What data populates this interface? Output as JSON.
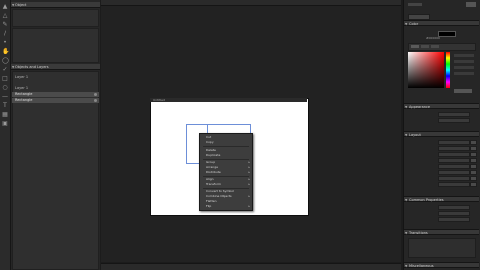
{
  "left_panels": {
    "top_panel": {
      "title": "Object"
    },
    "layers_panel": {
      "title": "Objects and Layers",
      "rows": [
        {
          "label": "Layer 1"
        },
        {
          "label": "Layer 1"
        },
        {
          "label": "Rectangle"
        },
        {
          "label": "Rectangle"
        }
      ]
    }
  },
  "document": {
    "title": "Untitled"
  },
  "context_menu": {
    "items": [
      {
        "label": "Cut"
      },
      {
        "label": "Copy"
      },
      {
        "label": "Delete"
      },
      {
        "label": "Duplicate"
      },
      {
        "label": "Group"
      },
      {
        "label": "Arrange"
      },
      {
        "label": "Distribute"
      },
      {
        "label": "Align"
      },
      {
        "label": "Transform"
      },
      {
        "label": "Convert to Symbol"
      },
      {
        "label": "Combine Objects"
      },
      {
        "label": "Flatten"
      },
      {
        "label": "Flip"
      },
      {
        "label": "Select All"
      },
      {
        "label": "Import"
      },
      {
        "label": "Export"
      },
      {
        "label": "Properties"
      }
    ]
  },
  "right_panels": {
    "sections": [
      {
        "title": "Color"
      },
      {
        "title": "Appearance"
      },
      {
        "title": "Layout"
      },
      {
        "title": "Common Properties"
      },
      {
        "title": "Transitions"
      },
      {
        "title": "Miscellaneous"
      }
    ],
    "color_value": "#000000"
  },
  "colors": {
    "accent": "#6d8fd8",
    "canvas_bg": "#222222",
    "panel_bg": "#262626"
  }
}
